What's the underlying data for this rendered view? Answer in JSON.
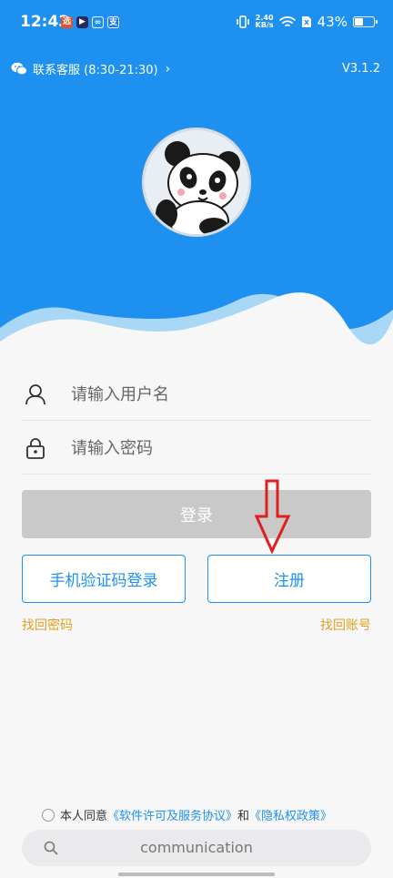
{
  "statusbar": {
    "time": "12:43",
    "apps": [
      {
        "icon": "app-icon-red",
        "glyph": "选",
        "color": "#e2522b"
      },
      {
        "icon": "app-icon-play",
        "glyph": "▶",
        "color": "#2a2a5a"
      },
      {
        "icon": "app-icon-cloud",
        "glyph": "∞",
        "color": "#1e90f0"
      },
      {
        "icon": "app-icon-alipay",
        "glyph": "支",
        "color": "#1677ff"
      }
    ],
    "net_speed_value": "2.40",
    "net_speed_unit": "KB/s",
    "battery": "43%",
    "battery_level": 0.43
  },
  "header": {
    "service_label": "联系客服 (8:30-21:30)",
    "version": "V3.1.2",
    "background": "#1e90f0"
  },
  "form": {
    "username_placeholder": "请输入用户名",
    "password_placeholder": "请输入密码",
    "login_label": "登录",
    "sms_login_label": "手机验证码登录",
    "register_label": "注册",
    "find_password": "找回密码",
    "find_account": "找回账号"
  },
  "agreement": {
    "prefix": "本人同意",
    "license": "《软件许可及服务协议》",
    "and": "和",
    "privacy": "《隐私权政策》"
  },
  "searchbar": {
    "text": "communication"
  },
  "colors": {
    "accent": "#1e90f0",
    "link": "#e0a020",
    "annotation_arrow": "#e02020"
  }
}
